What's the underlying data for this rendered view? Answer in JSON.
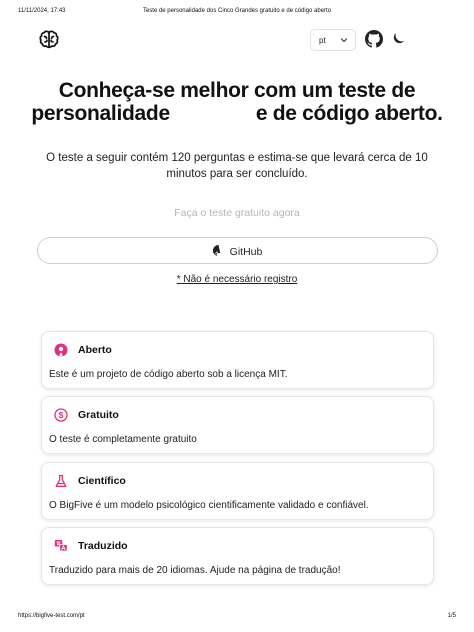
{
  "print_header": {
    "datetime": "11/11/2024, 17:43",
    "document_title": "Teste de personalidade dos Cinco Grandes gratuito e de código aberto"
  },
  "print_footer": {
    "url": "https://bigfive-test.com/pt",
    "page": "1/5"
  },
  "topbar": {
    "logo_icon": "brain-icon",
    "language": "pt",
    "github_icon": "github-icon",
    "theme_icon": "moon-icon"
  },
  "hero": {
    "title_part1": "Conheça-se melhor com um teste de personalidade",
    "title_part2": "e de código aberto.",
    "subtitle": "O teste a seguir contém 120 perguntas e estima-se que levará cerca de 10 minutos para ser concluído."
  },
  "cta": {
    "start_link": "Faça o teste gratuito agora",
    "github_button": "GitHub",
    "no_registration": "* Não é necessário registro"
  },
  "features": [
    {
      "icon": "open-source-icon",
      "title": "Aberto",
      "description": "Este é um projeto de código aberto sob a licença MIT."
    },
    {
      "icon": "dollar-icon",
      "title": "Gratuito",
      "description": "O teste é completamente gratuito"
    },
    {
      "icon": "flask-icon",
      "title": "Científico",
      "description": "O BigFive é um modelo psicológico cientificamente validado e confiável."
    },
    {
      "icon": "translate-icon",
      "title": "Traduzido",
      "description": "Traduzido para mais de 20 idiomas. Ajude na página de tradução!"
    }
  ],
  "colors": {
    "accent": "#e0307f",
    "muted_text": "#b5b5b5"
  }
}
